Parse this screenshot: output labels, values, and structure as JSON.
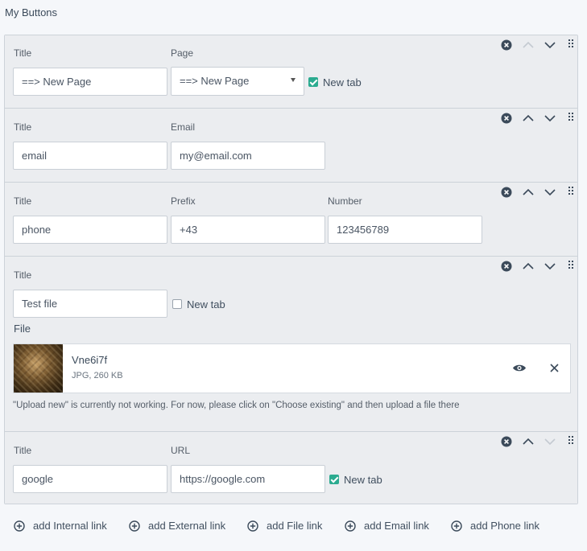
{
  "heading": "My Buttons",
  "blocks": [
    {
      "type": "internal",
      "labels": {
        "title": "Title",
        "page": "Page"
      },
      "title_value": "==> New Page",
      "page_value": "==> New Page",
      "new_tab_label": "New tab",
      "new_tab_checked": true,
      "up_disabled": true,
      "down_disabled": false
    },
    {
      "type": "email",
      "labels": {
        "title": "Title",
        "email": "Email"
      },
      "title_value": "email",
      "email_value": "my@email.com",
      "up_disabled": false,
      "down_disabled": false
    },
    {
      "type": "phone",
      "labels": {
        "title": "Title",
        "prefix": "Prefix",
        "number": "Number"
      },
      "title_value": "phone",
      "prefix_value": "+43",
      "number_value": "123456789",
      "up_disabled": false,
      "down_disabled": false
    },
    {
      "type": "file",
      "labels": {
        "title": "Title",
        "file": "File"
      },
      "title_value": "Test file",
      "new_tab_label": "New tab",
      "new_tab_checked": false,
      "file_name": "Vne6i7f",
      "file_meta": "JPG, 260 KB",
      "note": "\"Upload new\" is currently not working. For now, please click on \"Choose existing\" and then upload a file there",
      "up_disabled": false,
      "down_disabled": false
    },
    {
      "type": "external",
      "labels": {
        "title": "Title",
        "url": "URL"
      },
      "title_value": "google",
      "url_value": "https://google.com",
      "new_tab_label": "New tab",
      "new_tab_checked": true,
      "up_disabled": false,
      "down_disabled": true
    }
  ],
  "add_buttons": [
    {
      "label": "add Internal link"
    },
    {
      "label": "add External link"
    },
    {
      "label": "add File link"
    },
    {
      "label": "add Email link"
    },
    {
      "label": "add Phone link"
    }
  ],
  "colors": {
    "accent": "#2bab90",
    "icon": "#3b4a5a",
    "icon_disabled": "#c4cad1"
  }
}
